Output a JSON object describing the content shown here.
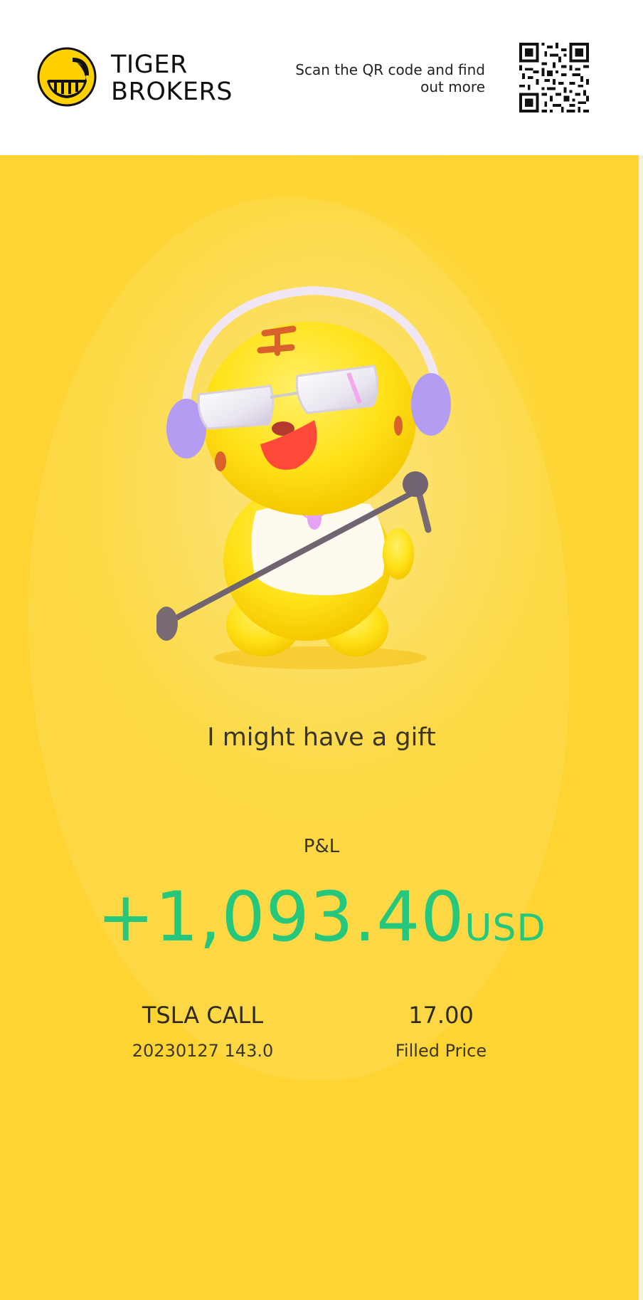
{
  "header": {
    "brand_line1": "TIGER",
    "brand_line2": "BROKERS",
    "scan_text": "Scan the QR code and find out more",
    "logo_icon": "tiger-brokers-logo-icon",
    "qr_icon": "qr-code-icon"
  },
  "hero": {
    "image": "singing-tiger-mascot-illustration",
    "tagline": "I might have a gift"
  },
  "pnl": {
    "label": "P&L",
    "value": "+1,093.40",
    "currency": "USD"
  },
  "trade": {
    "symbol": "TSLA CALL",
    "contract": "20230127 143.0",
    "price": "17.00",
    "price_label": "Filled Price"
  },
  "colors": {
    "background_yellow": "#fdd535",
    "profit_green": "#24c77b",
    "text_dark": "#3a3424"
  }
}
